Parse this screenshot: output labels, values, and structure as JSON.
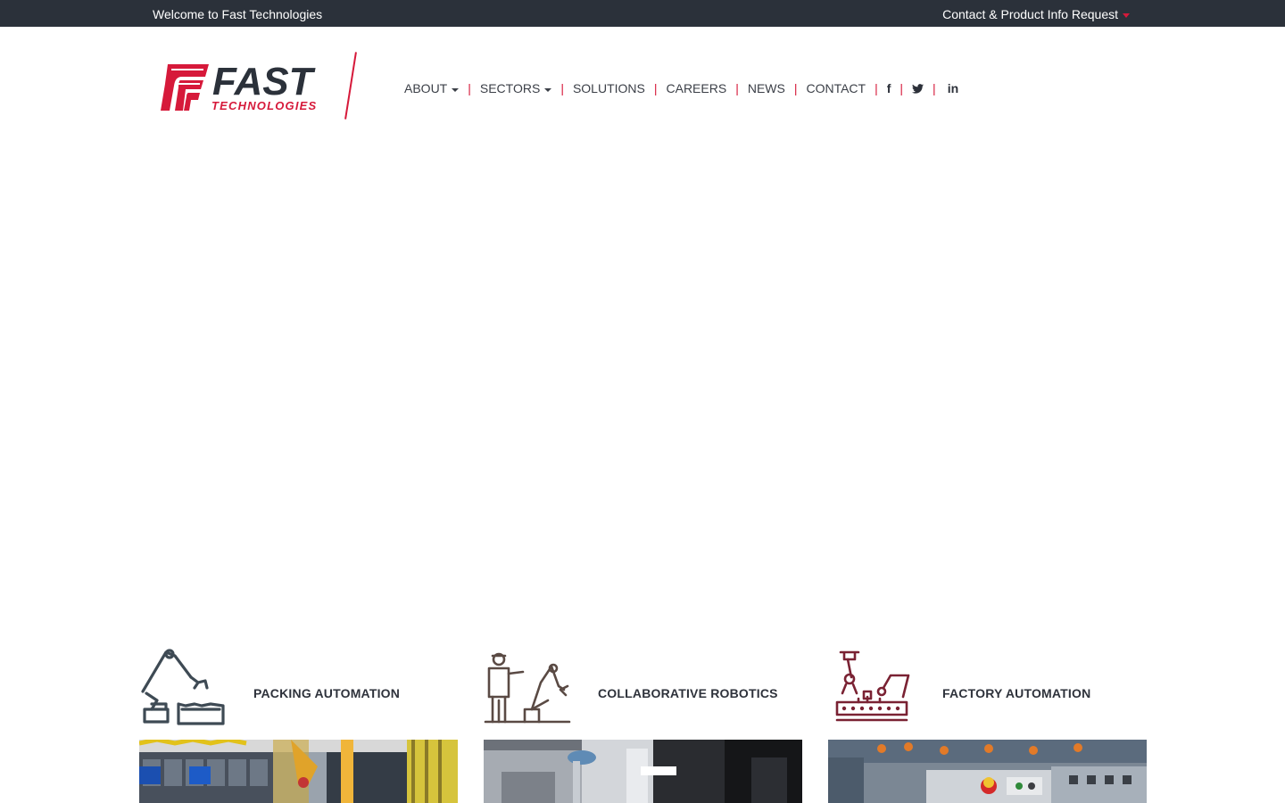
{
  "topbar": {
    "welcome": "Welcome to Fast Technologies",
    "contact_request": "Contact & Product Info Request"
  },
  "logo": {
    "brand": "FAST",
    "tagline": "TECHNOLOGIES",
    "colors": {
      "red": "#d6193a",
      "dark": "#2b313a"
    }
  },
  "nav": {
    "items": [
      {
        "label": "ABOUT",
        "dropdown": true
      },
      {
        "label": "SECTORS",
        "dropdown": true
      },
      {
        "label": "SOLUTIONS",
        "dropdown": false
      },
      {
        "label": "CAREERS",
        "dropdown": false
      },
      {
        "label": "NEWS",
        "dropdown": false
      },
      {
        "label": "CONTACT",
        "dropdown": false
      }
    ],
    "separator": "|",
    "social": {
      "facebook": "f",
      "twitter": "twitter-icon",
      "linkedin": "in"
    }
  },
  "cards": [
    {
      "title": "PACKING AUTOMATION",
      "icon": "robot-arm-packing-icon",
      "icon_color": "#3e4a54"
    },
    {
      "title": "COLLABORATIVE ROBOTICS",
      "icon": "worker-robot-icon",
      "icon_color": "#5a4a44"
    },
    {
      "title": "FACTORY AUTOMATION",
      "icon": "conveyor-robots-icon",
      "icon_color": "#7a2233"
    }
  ]
}
